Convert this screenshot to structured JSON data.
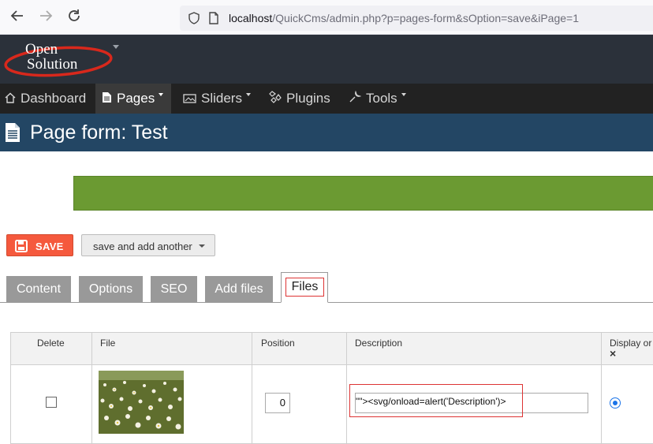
{
  "browser": {
    "url_host": "localhost",
    "url_path": "/QuickCms/admin.php?p=pages-form&sOption=save&iPage=1"
  },
  "logo": {
    "line1": "Open",
    "line2": "Solution"
  },
  "menu": [
    {
      "label": "Dashboard",
      "icon": "home-icon"
    },
    {
      "label": "Pages",
      "icon": "document-icon",
      "active": true,
      "dropdown": true
    },
    {
      "label": "Sliders",
      "icon": "slides-icon",
      "dropdown": true
    },
    {
      "label": "Plugins",
      "icon": "puzzle-icon"
    },
    {
      "label": "Tools",
      "icon": "wrench-icon",
      "dropdown": true
    }
  ],
  "title": "Page form: Test",
  "colors": {
    "success_bar": "#6b9a32",
    "save_button": "#f5593d",
    "title_bar": "#234664"
  },
  "actions": {
    "save": "SAVE",
    "save_add": "save and add another"
  },
  "tabs": [
    "Content",
    "Options",
    "SEO",
    "Add files",
    "Files"
  ],
  "active_tab": "Files",
  "files_table": {
    "headers": [
      "Delete",
      "File",
      "Position",
      "Description",
      "Display or"
    ],
    "rows": [
      {
        "delete_checked": false,
        "position": "0",
        "description": "\"\"><svg/onload=alert('Description')>",
        "display": true
      }
    ]
  }
}
